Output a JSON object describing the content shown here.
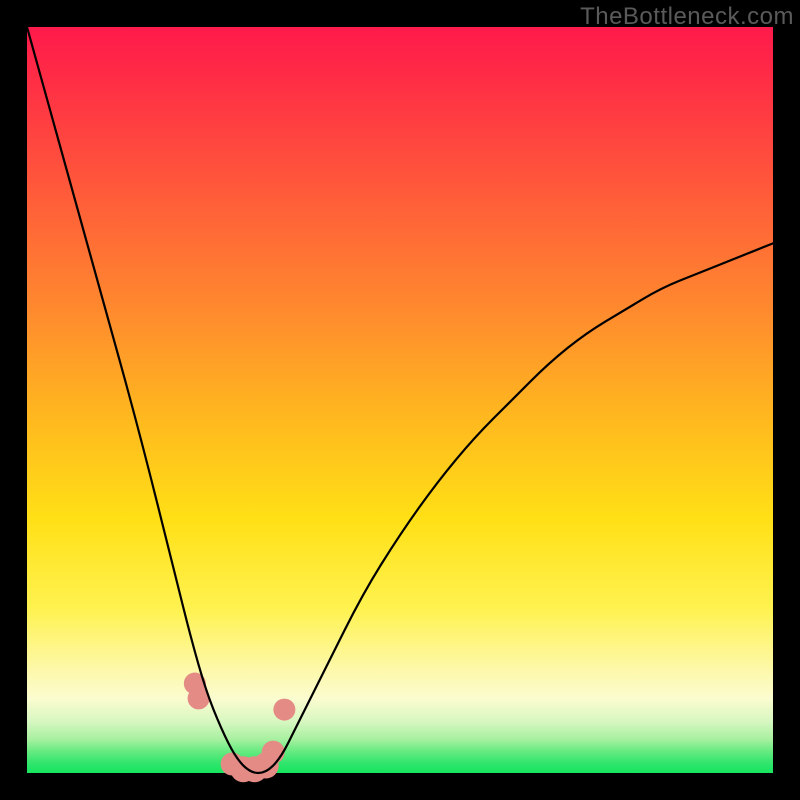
{
  "watermark": "TheBottleneck.com",
  "chart_data": {
    "type": "line",
    "title": "",
    "xlabel": "",
    "ylabel": "",
    "xlim": [
      0,
      100
    ],
    "ylim": [
      0,
      100
    ],
    "series": [
      {
        "name": "bottleneck-curve",
        "x": [
          0,
          5,
          10,
          15,
          20,
          22,
          24,
          26,
          28,
          30,
          32,
          34,
          36,
          40,
          45,
          50,
          55,
          60,
          65,
          70,
          75,
          80,
          85,
          90,
          95,
          100
        ],
        "values": [
          100,
          82,
          64,
          46,
          26,
          18,
          11,
          6,
          2,
          0,
          0,
          2,
          6,
          14,
          24,
          32,
          39,
          45,
          50,
          55,
          59,
          62,
          65,
          67,
          69,
          71
        ]
      }
    ],
    "markers": {
      "name": "highlighted-points",
      "color": "#e58b85",
      "x": [
        22.5,
        23.0,
        27.5,
        29.0,
        30.5,
        32.0,
        33.0,
        34.5
      ],
      "values": [
        12.0,
        10.0,
        1.2,
        0.5,
        0.5,
        1.0,
        2.8,
        8.5
      ],
      "radius": [
        11,
        11,
        11.5,
        13,
        13,
        13,
        11.5,
        11
      ]
    },
    "gradient_stops": [
      {
        "pos": 0.0,
        "color": "#ff1a4b"
      },
      {
        "pos": 0.22,
        "color": "#ff5a3a"
      },
      {
        "pos": 0.52,
        "color": "#ffb71f"
      },
      {
        "pos": 0.78,
        "color": "#fff250"
      },
      {
        "pos": 0.93,
        "color": "#d9f7c2"
      },
      {
        "pos": 1.0,
        "color": "#17e55f"
      }
    ]
  }
}
